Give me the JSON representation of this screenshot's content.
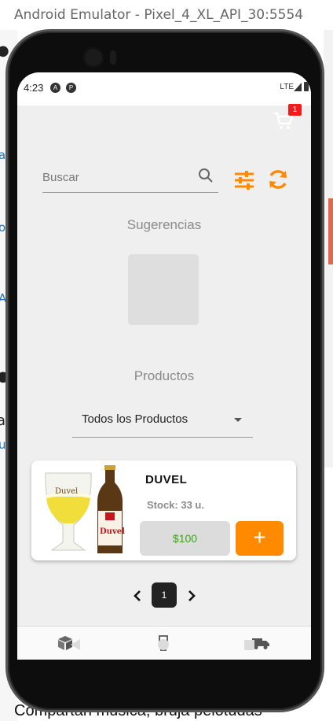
{
  "window": {
    "title": "Android Emulator - Pixel_4_XL_API_30:5554"
  },
  "background": {
    "bottom_text": "Compartan música, bruja pelotudas"
  },
  "status_bar": {
    "time": "4:23",
    "network": "LTE"
  },
  "cart": {
    "count": "1"
  },
  "search": {
    "placeholder": "Buscar",
    "value": ""
  },
  "sections": {
    "suggestions_title": "Sugerencias",
    "products_title": "Productos"
  },
  "filter": {
    "selected": "Todos los Productos"
  },
  "products": [
    {
      "name": "DUVEL",
      "stock": "Stock: 33 u.",
      "price": "$100",
      "add_label": "+"
    }
  ],
  "pagination": {
    "current_page": "1"
  },
  "colors": {
    "accent": "#ff8a00",
    "badge": "#f21b1b",
    "price_text": "#3aa316",
    "screen_bg": "#efefef"
  },
  "icons": {
    "cart": "cart-icon",
    "search": "search-icon",
    "filter": "sliders-icon",
    "refresh": "refresh-icon",
    "nav": [
      "cube-icon",
      "wine-glass-icon",
      "truck-icon"
    ]
  }
}
